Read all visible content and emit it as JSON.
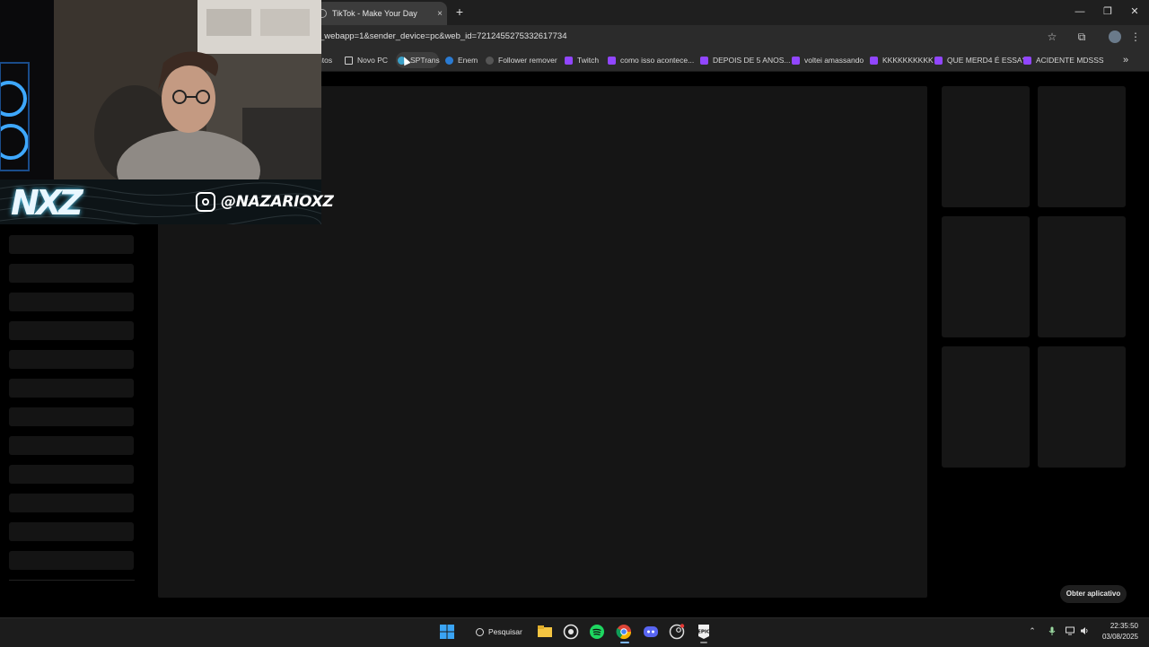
{
  "browser": {
    "tab_title": "TikTok - Make Your Day",
    "tab_close": "×",
    "new_tab": "+",
    "url": "_webapp=1&sender_device=pc&web_id=7212455275332617734",
    "window": {
      "minimize": "—",
      "restore": "❐",
      "close": "✕"
    },
    "toolbar_icons": {
      "star": "☆",
      "extensions": "⧉",
      "menu": "⋮"
    }
  },
  "bookmarks": [
    {
      "label": "ntos",
      "icon": "none"
    },
    {
      "label": "Novo PC",
      "icon": "folder-icon"
    },
    {
      "label": "SPTrans",
      "icon": "sptrans-icon"
    },
    {
      "label": "Enem",
      "icon": "enem-icon"
    },
    {
      "label": "Follower remover",
      "icon": "follower-icon"
    },
    {
      "label": "Twitch",
      "icon": "twitch-icon"
    },
    {
      "label": "como isso acontece...",
      "icon": "twitch-icon"
    },
    {
      "label": "DEPOIS DE 5 ANOS...",
      "icon": "twitch-icon"
    },
    {
      "label": "voltei amassando",
      "icon": "twitch-icon"
    },
    {
      "label": "KKKKKKKKKK",
      "icon": "twitch-icon"
    },
    {
      "label": "QUE MERD4 É ESSA?",
      "icon": "twitch-icon"
    },
    {
      "label": "ACIDENTE MDSSS",
      "icon": "twitch-icon"
    }
  ],
  "bookmarks_overflow": "»",
  "overlay": {
    "logo_text": "NXZ",
    "instagram_handle": "@NAZARIOXZ"
  },
  "page": {
    "get_app_button": "Obter aplicativo"
  },
  "taskbar": {
    "search_label": "Pesquisar",
    "time": "22:35:50",
    "date": "03/08/2025",
    "tray_chevron": "⌃"
  },
  "colors": {
    "twitch": "#9146ff",
    "accent_neon": "#59d7ff"
  }
}
